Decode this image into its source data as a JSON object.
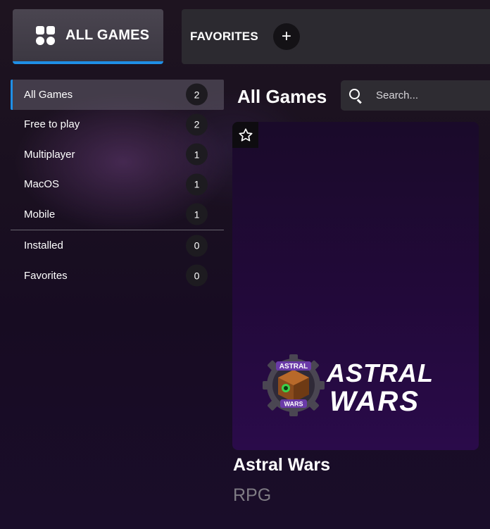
{
  "tabs": {
    "all_games_label": "ALL GAMES",
    "favorites_label": "FAVORITES",
    "add_label": "+"
  },
  "sidebar": {
    "items": [
      {
        "label": "All Games",
        "count": "2",
        "active": true
      },
      {
        "label": "Free to play",
        "count": "2"
      },
      {
        "label": "Multiplayer",
        "count": "1"
      },
      {
        "label": "MacOS",
        "count": "1"
      },
      {
        "label": "Mobile",
        "count": "1"
      }
    ],
    "bottom_items": [
      {
        "label": "Installed",
        "count": "0"
      },
      {
        "label": "Favorites",
        "count": "0"
      }
    ]
  },
  "main": {
    "title": "All Games",
    "search": {
      "placeholder": "Search..."
    }
  },
  "games": [
    {
      "title": "Astral Wars",
      "genre": "RPG",
      "logo_text": [
        "ASTRAL",
        "WARS"
      ],
      "emblem_text": [
        "ASTRAL",
        "WARS"
      ]
    }
  ],
  "colors": {
    "accent": "#1f8fe6",
    "card_bg": "#22093a",
    "genre_text": "#7f7c84"
  },
  "icons": {
    "grid": "grid-icon",
    "plus": "plus-icon",
    "search": "search-icon",
    "star": "star-outline-icon"
  }
}
